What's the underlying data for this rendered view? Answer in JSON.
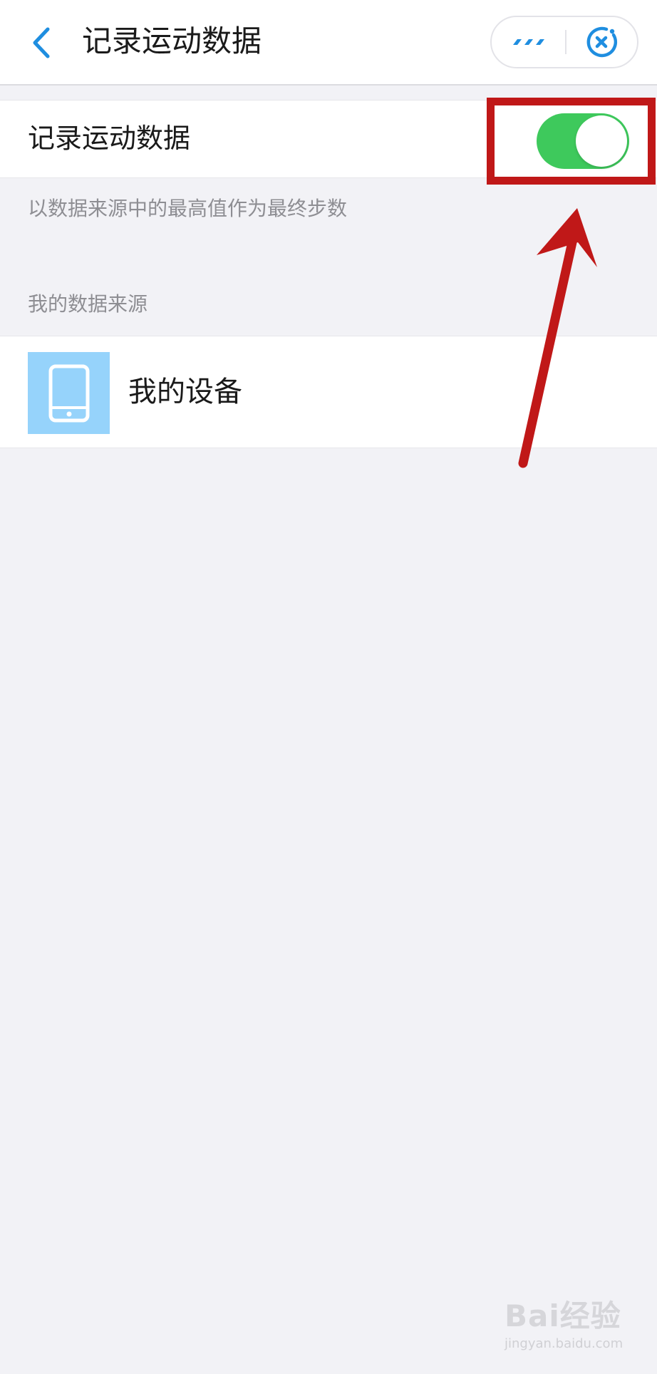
{
  "nav": {
    "title": "记录运动数据",
    "back_icon": "chevron-left-icon",
    "more_icon": "more-dots-icon",
    "close_icon": "close-circle-icon",
    "accent_color": "#1f8ee0"
  },
  "setting": {
    "label": "记录运动数据",
    "toggle_on": true,
    "toggle_color": "#3ec95c",
    "hint": "以数据来源中的最高值作为最终步数"
  },
  "sources": {
    "header": "我的数据来源",
    "items": [
      {
        "label": "我的设备",
        "icon": "phone-icon",
        "icon_bg": "#96d3fb"
      }
    ]
  },
  "annotation": {
    "color": "#c01818"
  },
  "watermark": {
    "logo": "Bai经验",
    "url": "jingyan.baidu.com"
  }
}
